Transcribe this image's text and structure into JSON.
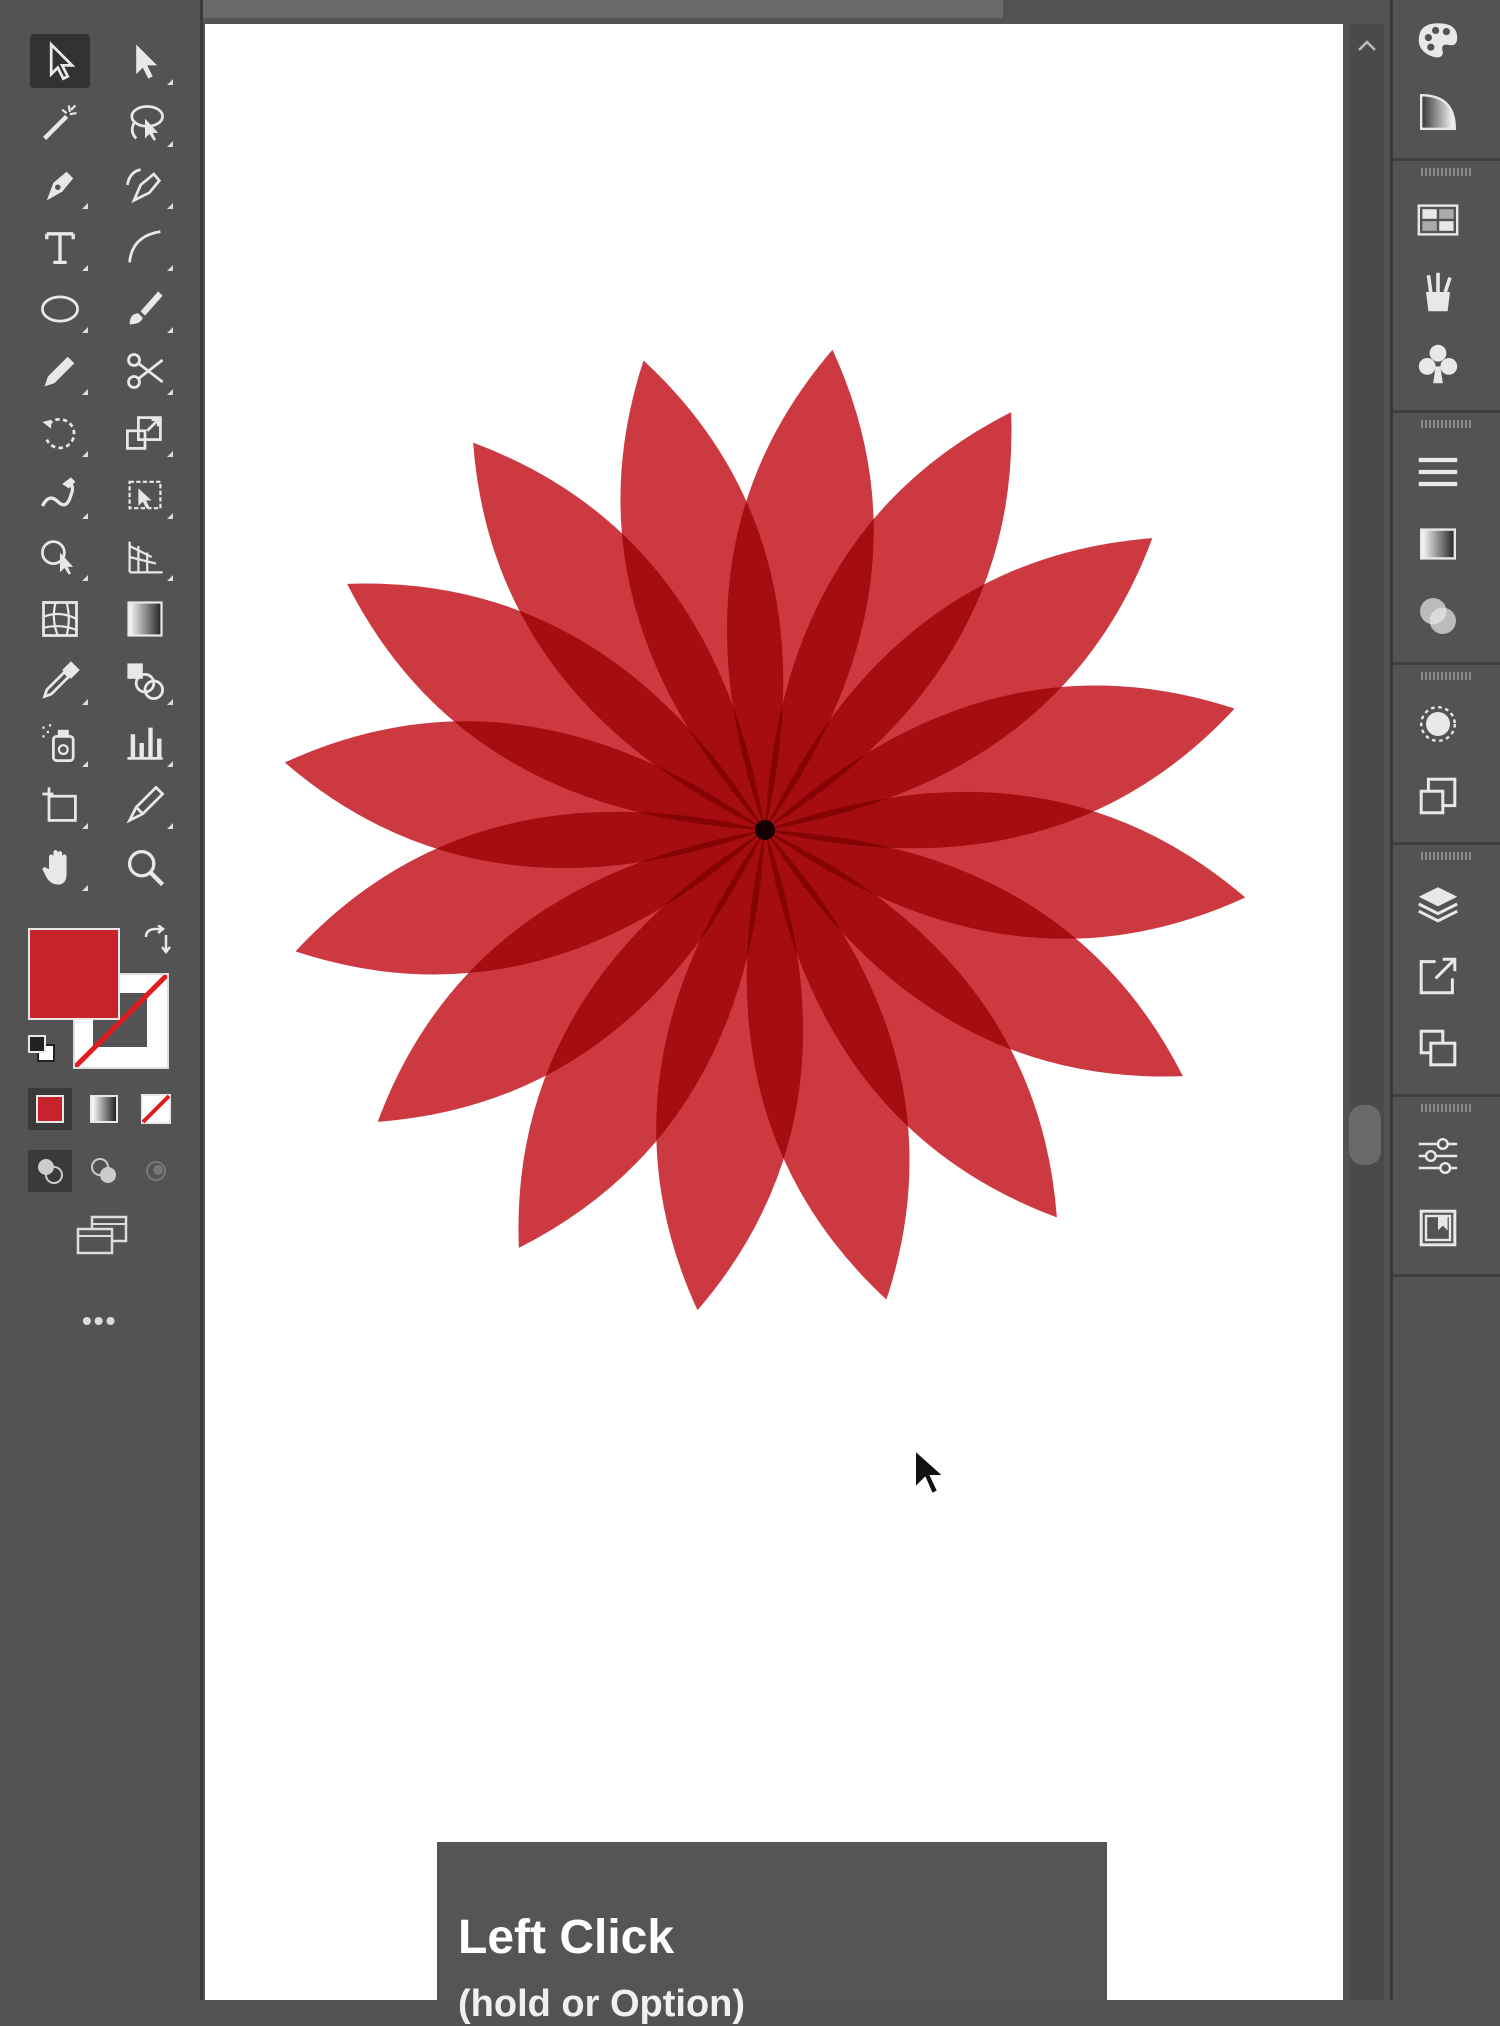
{
  "app": "Adobe Illustrator",
  "colors": {
    "fill": "#c8232c",
    "ui_bg": "#535353",
    "artboard": "#ffffff"
  },
  "toolbar": {
    "tools": [
      {
        "name": "selection-tool",
        "icon": "arrow-outline-icon",
        "selected": true
      },
      {
        "name": "direct-selection-tool",
        "icon": "arrow-solid-icon"
      },
      {
        "name": "magic-wand-tool",
        "icon": "magic-wand-icon"
      },
      {
        "name": "lasso-tool",
        "icon": "lasso-icon"
      },
      {
        "name": "pen-tool",
        "icon": "pen-icon"
      },
      {
        "name": "curvature-tool",
        "icon": "curvature-pen-icon"
      },
      {
        "name": "type-tool",
        "icon": "type-icon"
      },
      {
        "name": "line-segment-tool",
        "icon": "arc-icon"
      },
      {
        "name": "ellipse-tool",
        "icon": "ellipse-icon"
      },
      {
        "name": "paintbrush-tool",
        "icon": "brush-icon"
      },
      {
        "name": "pencil-tool",
        "icon": "pencil-icon"
      },
      {
        "name": "scissors-tool",
        "icon": "scissors-icon"
      },
      {
        "name": "rotate-tool",
        "icon": "rotate-icon"
      },
      {
        "name": "scale-tool",
        "icon": "scale-icon"
      },
      {
        "name": "warp-tool",
        "icon": "warp-icon"
      },
      {
        "name": "free-transform-tool",
        "icon": "free-transform-icon"
      },
      {
        "name": "shape-builder-tool",
        "icon": "shape-builder-icon"
      },
      {
        "name": "perspective-grid-tool",
        "icon": "perspective-grid-icon"
      },
      {
        "name": "mesh-tool",
        "icon": "mesh-icon"
      },
      {
        "name": "gradient-tool",
        "icon": "gradient-icon"
      },
      {
        "name": "eyedropper-tool",
        "icon": "eyedropper-icon"
      },
      {
        "name": "blend-tool",
        "icon": "blend-icon"
      },
      {
        "name": "symbol-sprayer-tool",
        "icon": "symbol-sprayer-icon"
      },
      {
        "name": "column-graph-tool",
        "icon": "column-graph-icon"
      },
      {
        "name": "artboard-tool",
        "icon": "artboard-icon"
      },
      {
        "name": "slice-tool",
        "icon": "knife-icon"
      },
      {
        "name": "hand-tool",
        "icon": "hand-icon"
      },
      {
        "name": "zoom-tool",
        "icon": "zoom-icon"
      }
    ],
    "more_label": "•••"
  },
  "right_panel": {
    "icons": [
      "color-palette-icon",
      "color-guide-icon",
      "swatches-icon",
      "brushes-icon",
      "symbols-icon",
      "align-icon",
      "gradient-panel-icon",
      "transparency-icon",
      "appearance-icon",
      "graphic-styles-icon",
      "layers-icon",
      "export-icon",
      "artboards-panel-icon",
      "properties-icon",
      "libraries-icon"
    ]
  },
  "tooltip": {
    "title": "Left Click",
    "subtitle": "(hold or Option)"
  }
}
